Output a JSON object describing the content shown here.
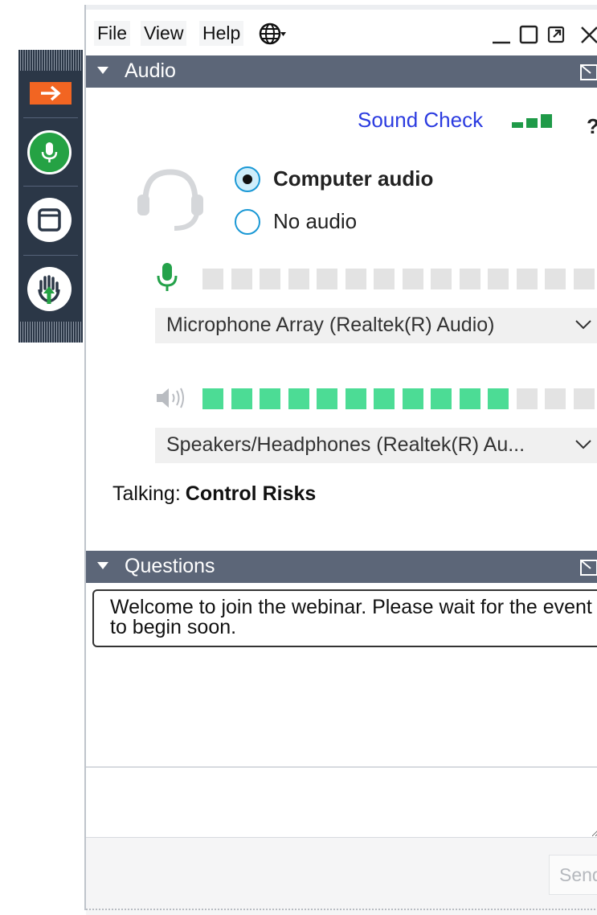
{
  "menubar": {
    "items": [
      "File",
      "View",
      "Help"
    ],
    "language_icon": "globe-icon"
  },
  "audio_panel": {
    "title": "Audio",
    "sound_check": "Sound Check",
    "help": "?",
    "options": [
      {
        "label": "Computer audio",
        "selected": true
      },
      {
        "label": "No audio",
        "selected": false
      }
    ],
    "microphone": {
      "device": "Microphone Array (Realtek(R) Audio)",
      "level_fraction": 0.0
    },
    "speakers": {
      "device": "Speakers/Headphones  (Realtek(R)  Au...",
      "level_fraction": 0.7857
    },
    "talking_label": "Talking:",
    "talking_name": "Control Risks"
  },
  "questions_panel": {
    "title": "Questions",
    "welcome_message": "Welcome to join the webinar. Please wait for the event to begin soon.",
    "send_label": "Send"
  },
  "colors": {
    "header_bg": "#5c6678",
    "accent_orange": "#f26522",
    "mic_green": "#25a244",
    "meter_on": "#4cdc95",
    "link_blue": "#2b3be0"
  }
}
